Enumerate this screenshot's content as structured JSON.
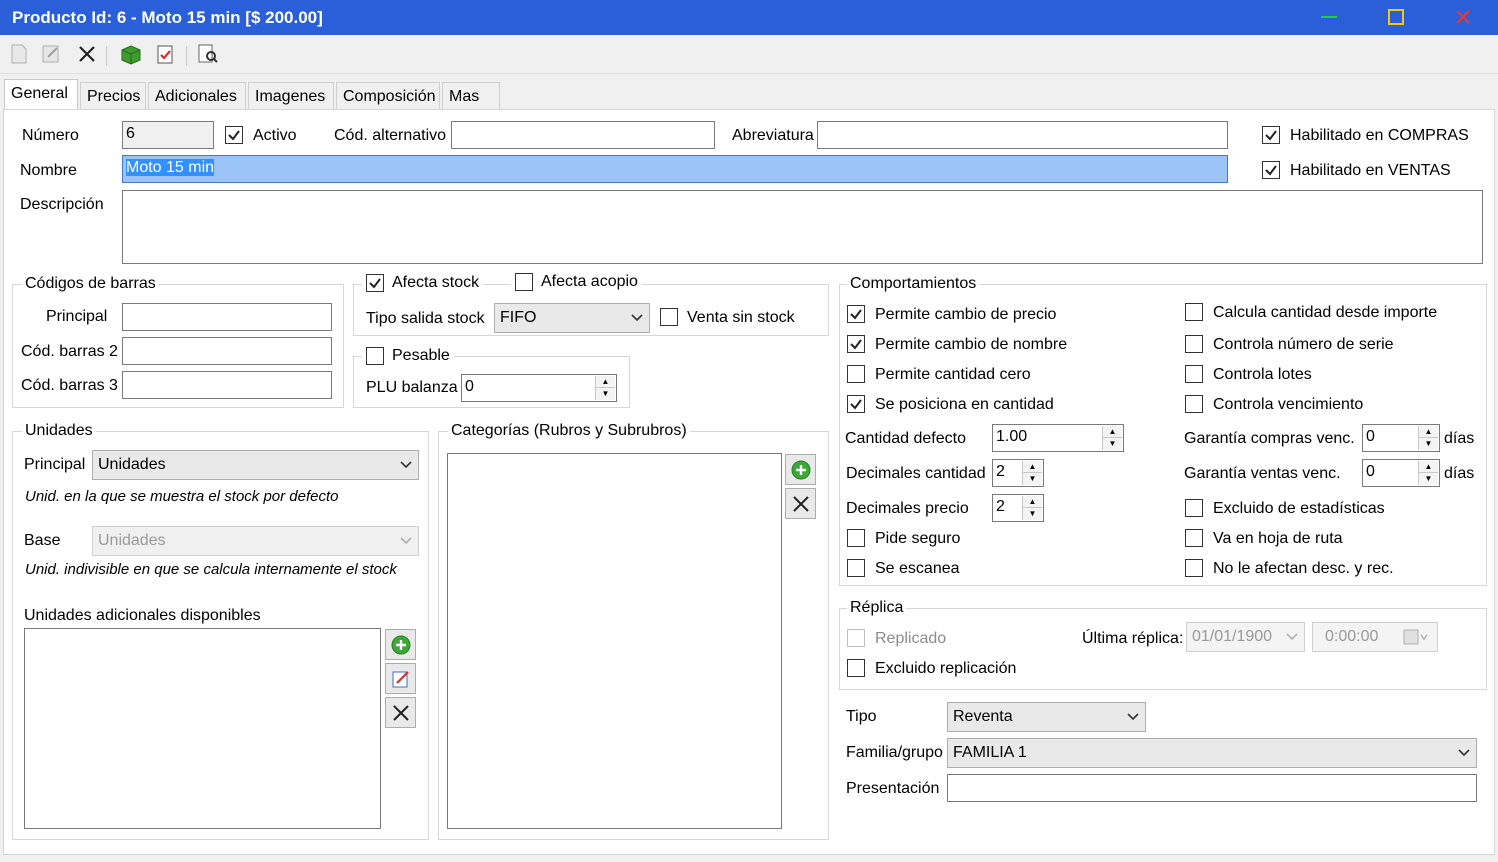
{
  "window": {
    "title": "Producto Id: 6 - Moto 15 min [$ 200.00]"
  },
  "toolbar": {
    "buttons": [
      "new-icon",
      "edit-icon",
      "delete-icon",
      "product-icon",
      "report-icon",
      "preview-icon"
    ]
  },
  "tabs": [
    "General",
    "Precios",
    "Adicionales",
    "Imagenes",
    "Composición",
    "Mas"
  ],
  "general": {
    "numero_label": "Número",
    "numero_value": "6",
    "activo_label": "Activo",
    "cod_alt_label": "Cód. alternativo",
    "cod_alt_value": "",
    "abreviatura_label": "Abreviatura",
    "abreviatura_value": "",
    "hab_compras_label": "Habilitado en COMPRAS",
    "hab_ventas_label": "Habilitado en VENTAS",
    "nombre_label": "Nombre",
    "nombre_value": "Moto 15 min",
    "descripcion_label": "Descripción",
    "descripcion_value": ""
  },
  "barcodes": {
    "title": "Códigos de barras",
    "principal_label": "Principal",
    "barras2_label": "Cód. barras 2",
    "barras3_label": "Cód. barras 3"
  },
  "stock": {
    "afecta_stock_label": "Afecta stock",
    "afecta_acopio_label": "Afecta acopio",
    "tipo_salida_label": "Tipo salida stock",
    "tipo_salida_value": "FIFO",
    "venta_sin_stock_label": "Venta sin stock",
    "pesable_label": "Pesable",
    "plu_label": "PLU balanza",
    "plu_value": "0"
  },
  "units": {
    "title": "Unidades",
    "principal_label": "Principal",
    "principal_value": "Unidades",
    "principal_hint": "Unid. en la que se muestra el stock por defecto",
    "base_label": "Base",
    "base_value": "Unidades",
    "base_hint": "Unid. indivisible en que se calcula internamente el stock",
    "adicionales_label": "Unidades adicionales disponibles"
  },
  "categories": {
    "title": "Categorías (Rubros y Subrubros)"
  },
  "behaviors": {
    "title": "Comportamientos",
    "left": [
      {
        "label": "Permite cambio de precio",
        "checked": true
      },
      {
        "label": "Permite cambio de nombre",
        "checked": true
      },
      {
        "label": "Permite cantidad cero",
        "checked": false
      },
      {
        "label": "Se posiciona en cantidad",
        "checked": true
      }
    ],
    "right": [
      {
        "label": "Calcula cantidad desde importe",
        "checked": false
      },
      {
        "label": "Controla número de serie",
        "checked": false
      },
      {
        "label": "Controla lotes",
        "checked": false
      },
      {
        "label": "Controla vencimiento",
        "checked": false
      }
    ],
    "cantidad_defecto_label": "Cantidad defecto",
    "cantidad_defecto_value": "1.00",
    "decimales_cantidad_label": "Decimales cantidad",
    "decimales_cantidad_value": "2",
    "decimales_precio_label": "Decimales precio",
    "decimales_precio_value": "2",
    "pide_seguro_label": "Pide seguro",
    "se_escanea_label": "Se escanea",
    "garantia_compras_label": "Garantía compras venc.",
    "garantia_compras_value": "0",
    "garantia_ventas_label": "Garantía ventas venc.",
    "garantia_ventas_value": "0",
    "dias_label": "días",
    "excluido_estadisticas_label": "Excluido de estadísticas",
    "hoja_ruta_label": "Va en hoja de ruta",
    "no_afectan_label": "No le afectan desc. y rec."
  },
  "replica": {
    "title": "Réplica",
    "replicado_label": "Replicado",
    "excluido_label": "Excluido replicación",
    "ultima_label": "Última réplica:",
    "fecha_value": "01/01/1900",
    "hora_value": "0:00:00"
  },
  "classification": {
    "tipo_label": "Tipo",
    "tipo_value": "Reventa",
    "familia_label": "Familia/grupo",
    "familia_value": "FAMILIA 1",
    "presentacion_label": "Presentación",
    "presentacion_value": ""
  },
  "colors": {
    "titlebar": "#2b5fd9",
    "selection": "#3390ff",
    "add": "#3aa935"
  }
}
